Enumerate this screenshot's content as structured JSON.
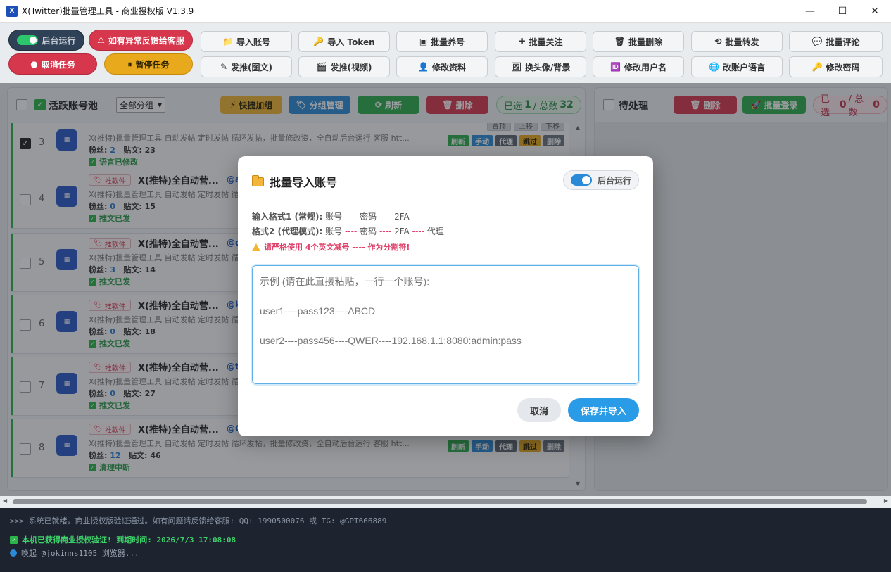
{
  "window": {
    "title": "X(Twitter)批量管理工具 - 商业授权版 V1.3.9",
    "icon_text": "X",
    "minimize": "—",
    "maximize": "☐",
    "close": "✕"
  },
  "toolbar": {
    "background_run": "后台运行",
    "feedback": "如有异常反馈给客服",
    "cancel_task": "取消任务",
    "pause_task": "暂停任务",
    "import_account": "导入账号",
    "import_token": "导入 Token",
    "batch_nurture": "批量养号",
    "batch_follow": "批量关注",
    "batch_delete": "批量删除",
    "batch_retweet": "批量转发",
    "batch_comment": "批量评论",
    "post_image": "发推(图文)",
    "post_video": "发推(视频)",
    "edit_profile": "修改资料",
    "change_avatar": "换头像/背景",
    "change_username": "修改用户名",
    "change_language": "改账户语言",
    "change_password": "修改密码"
  },
  "left_panel": {
    "title": "活跃账号池",
    "group_select": "全部分组",
    "quick_group": "快捷加组",
    "group_manage": "分组管理",
    "refresh": "刷新",
    "delete": "删除",
    "selected_label": "已选",
    "selected_count": "1",
    "total_label": "/ 总数",
    "total_count": "32",
    "row_buttons": {
      "top": "置顶",
      "up": "上移",
      "down": "下移",
      "refresh": "刷新",
      "manual": "手动",
      "proxy": "代理",
      "skip": "跳过",
      "delete": "删除"
    },
    "rows": [
      {
        "num": "3",
        "tag": "",
        "name": "",
        "handle": "",
        "bio": "X(推特)批量管理工具 自动发帖 定时发帖 循环发帖，批量修改资，全自动后台运行 客服 htt...",
        "fans_label": "粉丝:",
        "fans": "2",
        "posts_label": "贴文:",
        "posts": "23",
        "status": "语言已修改"
      },
      {
        "num": "4",
        "tag": "推软件",
        "name": "X(推特)全自动营...",
        "handle": "@a",
        "bio": "X(推特)批量管理工具 自动发帖 定时发帖 循环发帖",
        "fans_label": "粉丝:",
        "fans": "0",
        "posts_label": "贴文:",
        "posts": "15",
        "status": "推文已发"
      },
      {
        "num": "5",
        "tag": "推软件",
        "name": "X(推特)全自动营...",
        "handle": "@d",
        "bio": "X(推特)批量管理工具 自动发帖 定时发帖 循环发帖",
        "fans_label": "粉丝:",
        "fans": "3",
        "posts_label": "贴文:",
        "posts": "14",
        "status": "推文已发"
      },
      {
        "num": "6",
        "tag": "推软件",
        "name": "X(推特)全自动营...",
        "handle": "@k",
        "bio": "X(推特)批量管理工具 自动发帖 定时发帖 循环发帖",
        "fans_label": "粉丝:",
        "fans": "0",
        "posts_label": "贴文:",
        "posts": "18",
        "status": "推文已发"
      },
      {
        "num": "7",
        "tag": "推软件",
        "name": "X(推特)全自动营...",
        "handle": "@tj",
        "bio": "X(推特)批量管理工具 自动发帖 定时发帖 循环发帖",
        "fans_label": "粉丝:",
        "fans": "0",
        "posts_label": "贴文:",
        "posts": "27",
        "status": "推文已发"
      },
      {
        "num": "8",
        "tag": "推软件",
        "name": "X(推特)全自动营...",
        "handle": "@C",
        "bio": "X(推特)批量管理工具 自动发帖 定时发帖 循环发帖，批量修改资，全自动后台运行 客服 htt...",
        "fans_label": "粉丝:",
        "fans": "12",
        "posts_label": "贴文:",
        "posts": "46",
        "status": "清理中断"
      }
    ]
  },
  "right_panel": {
    "title": "待处理",
    "delete": "删除",
    "batch_login": "批量登录",
    "selected_label": "已选",
    "selected_count": "0",
    "total_label": "/ 总数",
    "total_count": "0"
  },
  "console": {
    "line1": ">>> 系统已就绪。商业授权版验证通过。如有问题请反馈给客服: QQ: 1990500076 或 TG: @GPT666889",
    "line2": "本机已获得商业授权验证! 到期时间: 2026/7/3 17:08:08",
    "line3": "唤起 @jokinns1105 浏览器..."
  },
  "modal": {
    "title": "批量导入账号",
    "background_run": "后台运行",
    "format1_label": "输入格式1 (常规):",
    "format1_a": "账号",
    "format1_b": "密码",
    "format1_c": "2FA",
    "format2_label": "格式2 (代理模式):",
    "format2_a": "账号",
    "format2_b": "密码",
    "format2_c": "2FA",
    "format2_d": "代理",
    "separator": "----",
    "warning": "请严格使用 4个英文减号 ---- 作为分割符!",
    "placeholder": "示例 (请在此直接粘贴，一行一个账号):\n\nuser1----pass123----ABCD\n\nuser2----pass456----QWER----192.168.1.1:8080:admin:pass",
    "cancel": "取消",
    "save": "保存并导入"
  }
}
